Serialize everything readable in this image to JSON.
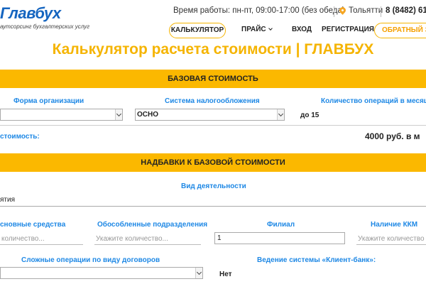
{
  "header": {
    "logo_title": "Главбух",
    "logo_subtitle": "аутсорсинг бухгалтерских услуг",
    "hours": "Время работы: пн-пт, 09:00-17:00 (без обеда)",
    "city": "Тольятти",
    "phone": "8 (8482) 61",
    "nav": {
      "calculator": "КАЛЬКУЛЯТОР",
      "price": "ПРАЙС",
      "login": "ВХОД",
      "register": "РЕГИСТРАЦИЯ",
      "callback": "ОБРАТНЫЙ ЗВО"
    }
  },
  "page_title": "Калькулятор расчета стоимости | ГЛАВБУХ",
  "base_section": {
    "title": "БАЗОВАЯ СТОИМОСТЬ",
    "org_form_label": "Форма организации",
    "org_form_value": "",
    "tax_system_label": "Система налогообложения",
    "tax_system_value": "ОСНО",
    "operations_label": "Количество операций в месяц*",
    "operations_value": "до 15",
    "cost_label": "стоимость:",
    "cost_value": "4000 руб. в м"
  },
  "markup_section": {
    "title": "НАДБАВКИ К БАЗОВОЙ СТОИМОСТИ",
    "activity_label": "Вид деятельности",
    "activity_value": "ятия",
    "fixed_assets_label": "сновные средства",
    "fixed_assets_placeholder": "количество...",
    "branches_sep_label": "Обособленные подразделения",
    "branches_sep_placeholder": "Укажите количество...",
    "filial_label": "Филиал",
    "filial_value": "1",
    "kkm_label": "Наличие ККМ",
    "kkm_placeholder": "Укажите количество...",
    "complex_ops_label": "Сложные операции по виду договоров",
    "client_bank_label": "Ведение системы «Клиент-банк»:",
    "client_bank_value": "Нет"
  }
}
